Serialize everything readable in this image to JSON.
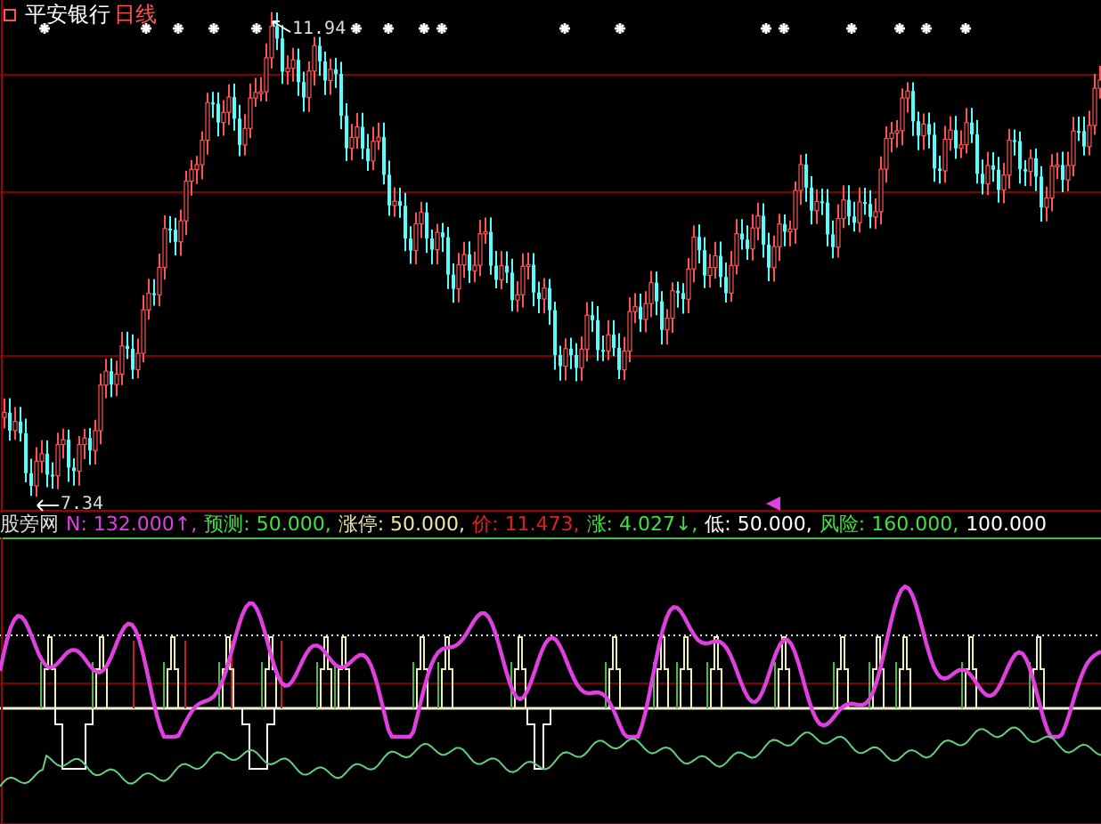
{
  "chart_header": {
    "stock": "平安银行",
    "period": "日线"
  },
  "price_labels": {
    "high": "11.94",
    "low": "7.34"
  },
  "indicator": {
    "name": "股旁网",
    "items": [
      {
        "text": "N: 132.000↑,"
      },
      {
        "text": "预测: 50.000,"
      },
      {
        "text": "涨停: 50.000,"
      },
      {
        "text": "价: 11.473,"
      },
      {
        "text": "涨: 4.027↓,"
      },
      {
        "text": "低: 50.000,"
      },
      {
        "text": "风险: 160.000,"
      },
      {
        "text": "100.000"
      }
    ]
  }
}
